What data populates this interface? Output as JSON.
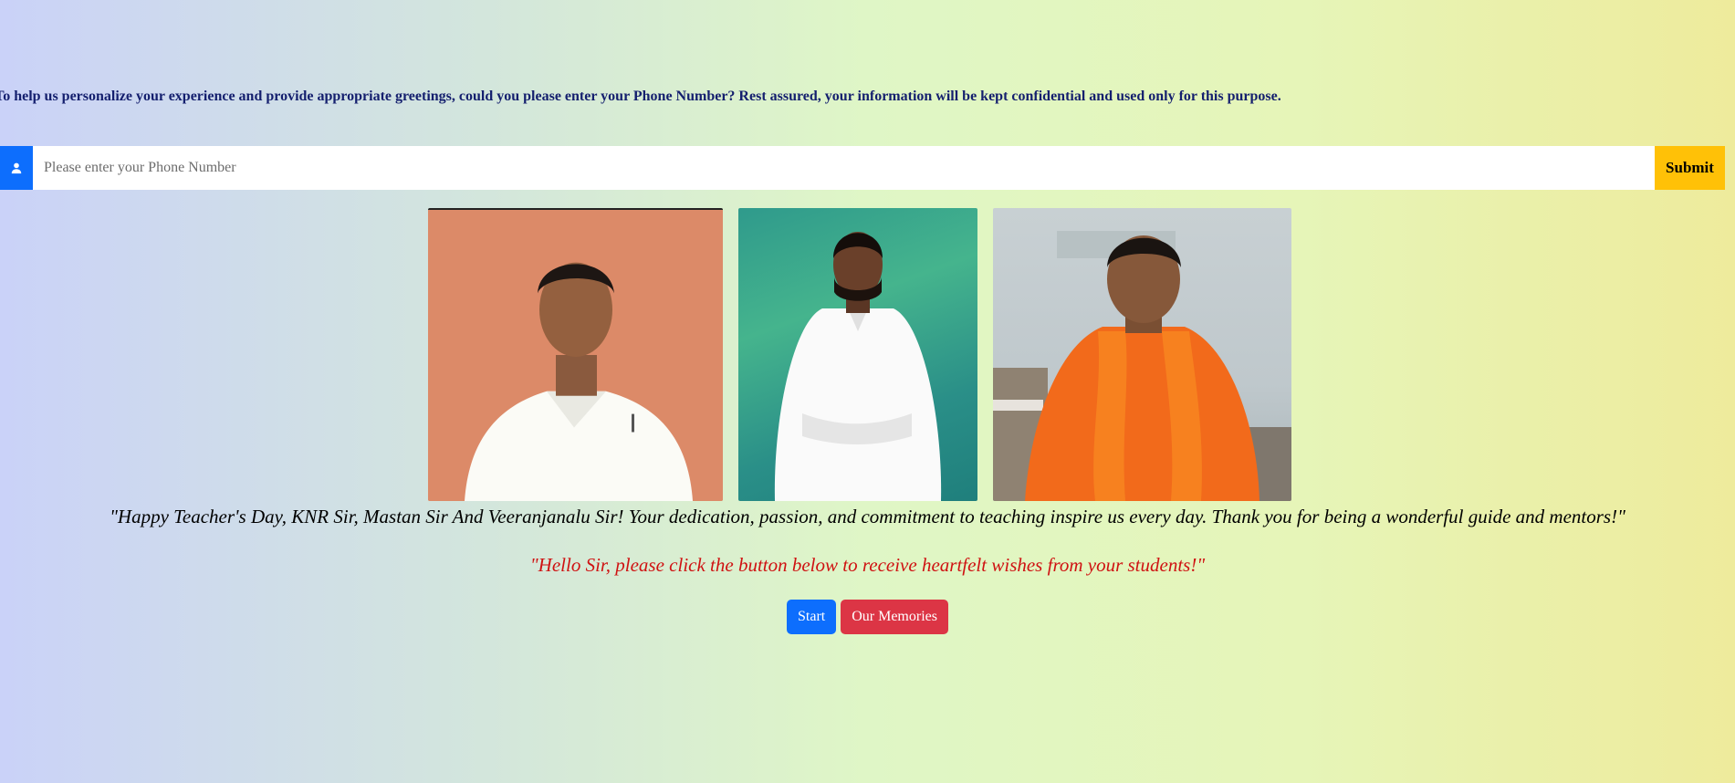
{
  "intro": {
    "text": "To help us personalize your experience and provide appropriate greetings, could you please enter your Phone Number? Rest assured, your information will be kept confidential and used only for this purpose."
  },
  "phone_form": {
    "icon": "user-icon",
    "placeholder": "Please enter your Phone Number",
    "value": "",
    "submit_label": "Submit"
  },
  "photos": [
    {
      "name": "teacher-photo-knr"
    },
    {
      "name": "teacher-photo-mastan"
    },
    {
      "name": "teacher-photo-veeranjanalu"
    }
  ],
  "messages": {
    "greeting": "\"Happy Teacher's Day, KNR Sir, Mastan Sir And Veeranjanalu Sir! Your dedication, passion, and commitment to teaching inspire us every day. Thank you for being a wonderful guide and mentors!\"",
    "prompt": "\"Hello Sir, please click the button below to receive heartfelt wishes from your students!\""
  },
  "actions": {
    "start_label": "Start",
    "memories_label": "Our Memories"
  },
  "colors": {
    "primary": "#0d6efd",
    "warning": "#ffc107",
    "danger": "#dc3545",
    "prompt_text": "#cf1212",
    "intro_text": "#141f6e"
  }
}
